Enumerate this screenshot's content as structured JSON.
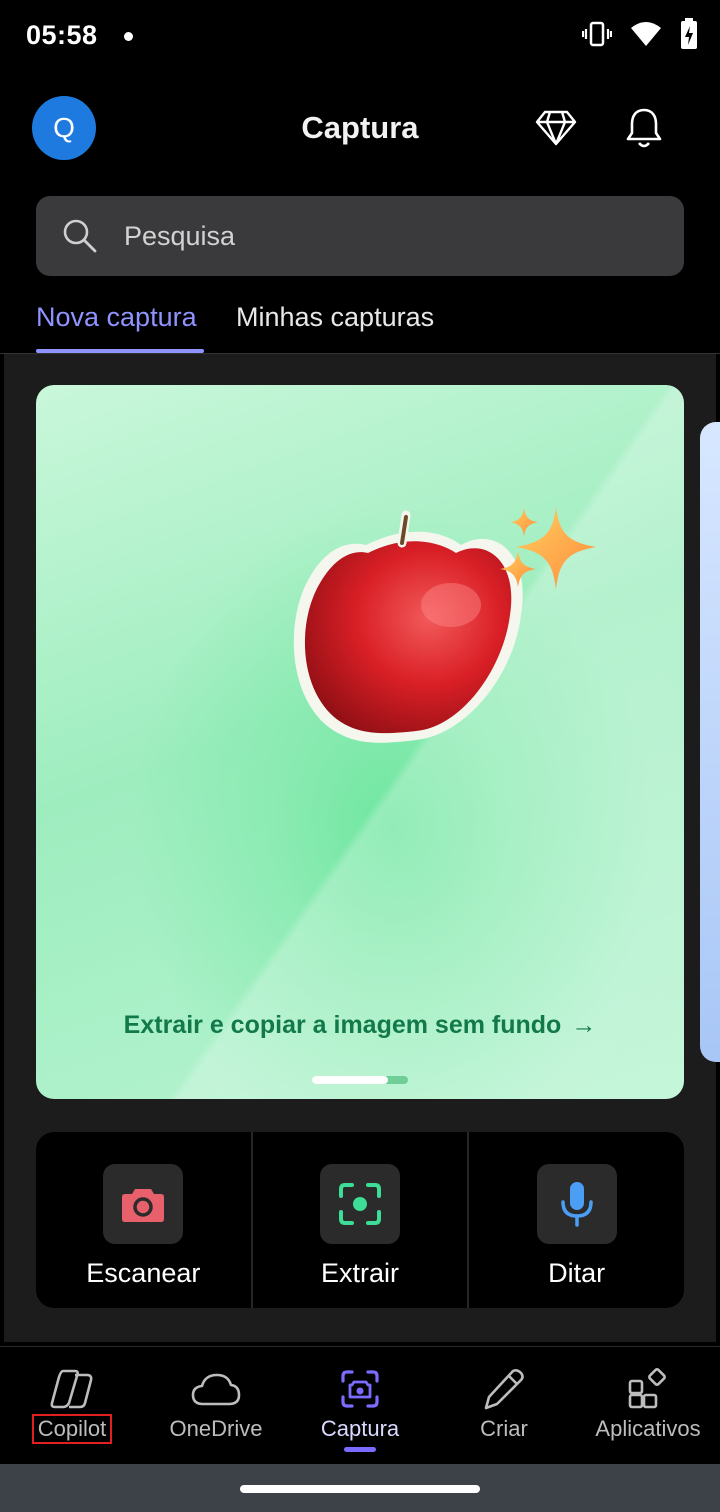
{
  "status_bar": {
    "time": "05:58"
  },
  "header": {
    "avatar_initial": "Q",
    "title": "Captura"
  },
  "search": {
    "placeholder": "Pesquisa"
  },
  "tabs": [
    {
      "label": "Nova captura",
      "active": true
    },
    {
      "label": "Minhas capturas",
      "active": false
    }
  ],
  "hero": {
    "link_text": "Extrair e copiar a imagem sem fundo",
    "link_arrow": "→",
    "pager": {
      "pages": 2,
      "active_page": 1
    }
  },
  "actions": [
    {
      "label": "Escanear",
      "icon": "camera-icon",
      "color": "#e8606c"
    },
    {
      "label": "Extrair",
      "icon": "focus-frame-icon",
      "color": "#3ddc97"
    },
    {
      "label": "Ditar",
      "icon": "microphone-icon",
      "color": "#4a9ff5"
    }
  ],
  "bottom_nav": [
    {
      "label": "Copilot",
      "icon": "copilot-icon",
      "active": false
    },
    {
      "label": "OneDrive",
      "icon": "cloud-icon",
      "active": false
    },
    {
      "label": "Captura",
      "icon": "capture-camera-icon",
      "active": true
    },
    {
      "label": "Criar",
      "icon": "pen-icon",
      "active": false
    },
    {
      "label": "Aplicativos",
      "icon": "apps-grid-icon",
      "active": false
    }
  ],
  "colors": {
    "accent": "#8f93ff",
    "avatar": "#1f7ae0",
    "hero_link": "#12794a",
    "nav_active": "#7b6cff"
  }
}
